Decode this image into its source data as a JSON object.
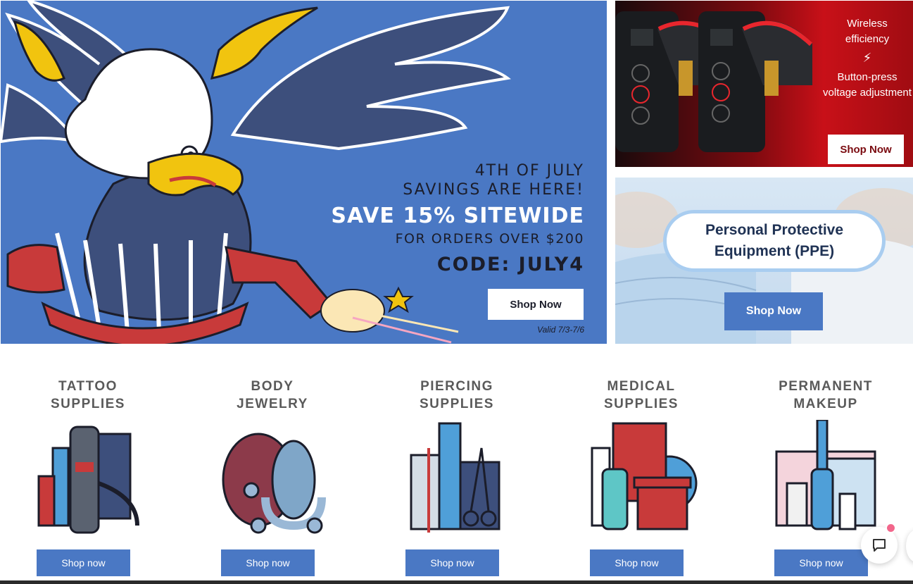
{
  "hero": {
    "line1": "4TH OF JULY",
    "line2": "SAVINGS ARE HERE!",
    "headline": "SAVE 15% SITEWIDE",
    "subline": "FOR ORDERS OVER $200",
    "code": "CODE: JULY4",
    "button_label": "Shop Now",
    "valid": "Valid 7/3-7/6"
  },
  "promo_top": {
    "line1": "Wireless",
    "line2": "efficiency",
    "line3": "Button-press",
    "line4": "voltage adjustment",
    "button_label": "Shop Now"
  },
  "promo_ppe": {
    "title_line1": "Personal Protective",
    "title_line2": "Equipment (PPE)",
    "button_label": "Shop Now"
  },
  "categories": [
    {
      "title": "TATTOO\nSUPPLIES",
      "button_label": "Shop now"
    },
    {
      "title": "BODY\nJEWELRY",
      "button_label": "Shop now"
    },
    {
      "title": "PIERCING\nSUPPLIES",
      "button_label": "Shop now"
    },
    {
      "title": "MEDICAL\nSUPPLIES",
      "button_label": "Shop now"
    },
    {
      "title": "PERMANENT\nMAKEUP",
      "button_label": "Shop now"
    }
  ],
  "colors": {
    "brand_blue": "#4a78c4",
    "promo_red": "#c81018",
    "notification_pink": "#f2668b"
  },
  "icons": [
    "eagle-illustration",
    "lightning-icon",
    "chat-icon"
  ]
}
